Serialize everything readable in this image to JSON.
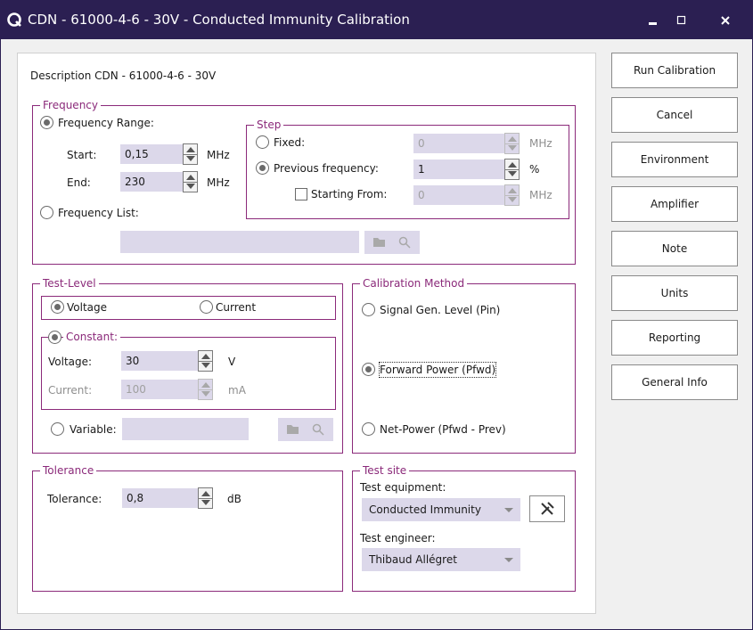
{
  "window": {
    "title": "CDN - 61000-4-6 - 30V - Conducted Immunity Calibration"
  },
  "description": "Description CDN - 61000-4-6 - 30V",
  "frequency": {
    "legend": "Frequency",
    "range_label": "Frequency Range:",
    "start_label": "Start:",
    "start_value": "0,15",
    "start_unit": "MHz",
    "end_label": "End:",
    "end_value": "230",
    "end_unit": "MHz",
    "list_label": "Frequency List:",
    "step": {
      "legend": "Step",
      "fixed_label": "Fixed:",
      "fixed_value": "0",
      "fixed_unit": "MHz",
      "previous_label": "Previous frequency:",
      "previous_value": "1",
      "previous_unit": "%",
      "starting_label": "Starting From:",
      "starting_value": "0",
      "starting_unit": "MHz"
    }
  },
  "test_level": {
    "legend": "Test-Level",
    "voltage_label": "Voltage",
    "current_label": "Current",
    "constant_label": "Constant:",
    "voltage_field_label": "Voltage:",
    "voltage_value": "30",
    "voltage_unit": "V",
    "current_field_label": "Current:",
    "current_value": "100",
    "current_unit": "mA",
    "variable_label": "Variable:"
  },
  "calibration_method": {
    "legend": "Calibration Method",
    "option1": "Signal Gen. Level (Pin)",
    "option2": "Forward Power (Pfwd)",
    "option3": "Net-Power (Pfwd - Prev)"
  },
  "tolerance": {
    "legend": "Tolerance",
    "label": "Tolerance:",
    "value": "0,8",
    "unit": "dB"
  },
  "test_site": {
    "legend": "Test site",
    "equipment_label": "Test equipment:",
    "equipment_value": "Conducted Immunity",
    "engineer_label": "Test engineer:",
    "engineer_value": "Thibaud Allégret"
  },
  "buttons": {
    "run": "Run Calibration",
    "cancel": "Cancel",
    "environment": "Environment",
    "amplifier": "Amplifier",
    "note": "Note",
    "units": "Units",
    "reporting": "Reporting",
    "general_info": "General Info"
  },
  "colors": {
    "titlebar": "#2b1f52",
    "group_border": "#8b2a7a",
    "field_bg": "#dcd8ea"
  },
  "icons": [
    "app-logo-icon",
    "minimize-icon",
    "maximize-icon",
    "close-icon",
    "folder-icon",
    "search-icon",
    "tools-icon",
    "chevron-down-icon"
  ]
}
